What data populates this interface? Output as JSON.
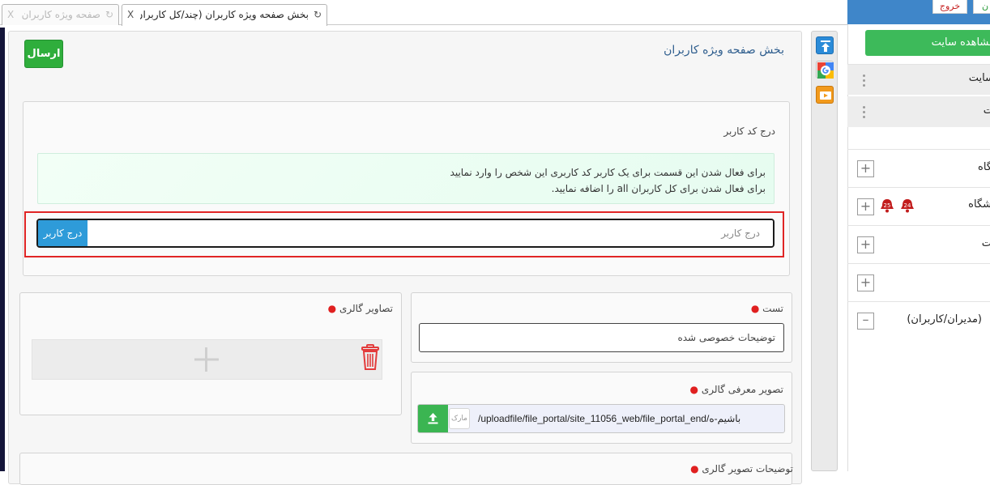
{
  "tabs": [
    {
      "label": "صفحه ویژه کاربران",
      "close": "X",
      "refresh": "↻",
      "active": false
    },
    {
      "label": "بخش صفحه ویژه کاربران (چند/کل کاربران)",
      "close": "X",
      "refresh": "↻",
      "active": true
    }
  ],
  "main": {
    "title": "بخش صفحه ویژه کاربران",
    "send_label": "ارسال",
    "user_section": {
      "label": "درج کد کاربر",
      "info_line1": "برای فعال شدن این قسمت برای یک کاربر کد کاربری این شخص را وارد نمایید",
      "info_line2": "برای فعال شدن برای کل کاربران all را اضافه نمایید.",
      "input_placeholder": "درج کاربر",
      "add_button": "درج کاربر"
    },
    "gallery": {
      "label": "تصاویر گالری"
    },
    "test": {
      "label": "تست",
      "value": "توضیحات خصوصی شده"
    },
    "cover": {
      "label": "تصویر معرفی گالری",
      "mark": "مارک",
      "path": "/uploadfile/file_portal/site_11056_web/file_portal_end/باشیم-ه"
    },
    "bottom": {
      "label": "توضیحات تصویر گالری"
    }
  },
  "toolbar": {
    "icons": [
      "upload-icon",
      "google-icon",
      "slides-icon"
    ]
  },
  "sidebar": {
    "logout": "خروج",
    "top_other": "ن",
    "view_site": "مشاهده سایت",
    "items": [
      {
        "label": "سایت"
      },
      {
        "label": "ت"
      },
      {
        "label": "گاه"
      },
      {
        "label": "شگاه",
        "badge1": "25",
        "badge2": "24"
      },
      {
        "label": "ت"
      },
      {
        "label": ""
      },
      {
        "label": "(مدیران/کاربران)"
      }
    ]
  },
  "colors": {
    "send": "#2fae3c",
    "add_user": "#2e9bd9",
    "highlight": "#e02525",
    "sidebar_header": "#3f86c9",
    "view_site": "#3dba5a"
  }
}
